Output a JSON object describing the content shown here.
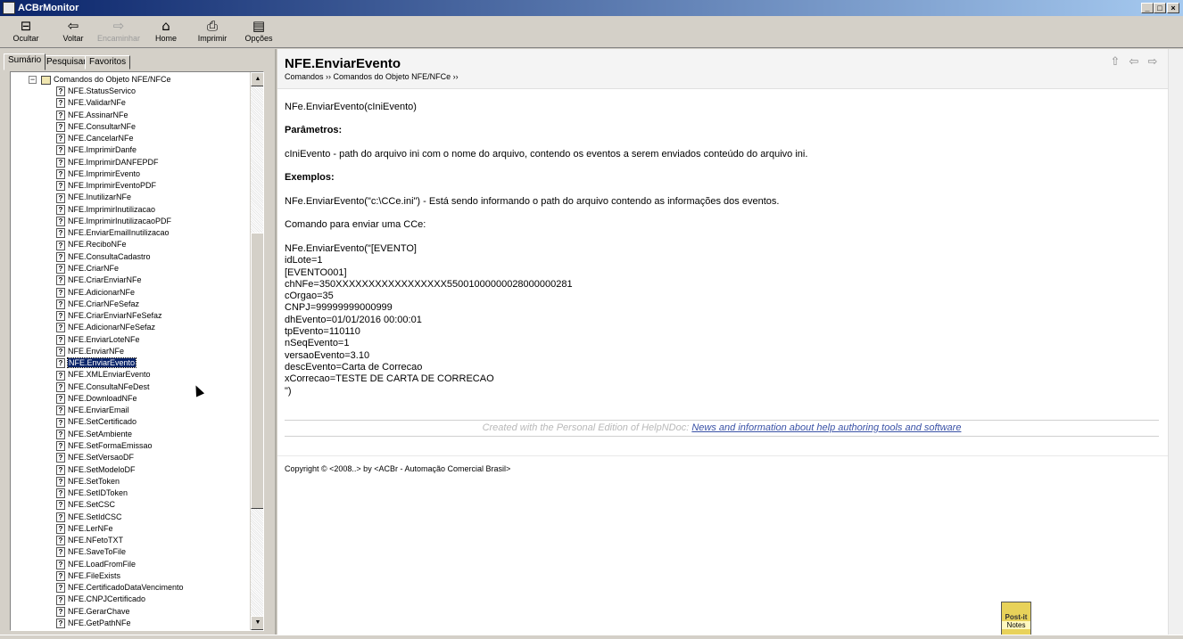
{
  "window": {
    "title": "ACBrMonitor"
  },
  "toolbar": [
    {
      "label": "Ocultar",
      "icon": "hide-icon",
      "glyph": "⊟",
      "enabled": true
    },
    {
      "label": "Voltar",
      "icon": "back-arrow-icon",
      "glyph": "⇦",
      "enabled": true
    },
    {
      "label": "Encaminhar",
      "icon": "forward-arrow-icon",
      "glyph": "⇨",
      "enabled": false
    },
    {
      "label": "Home",
      "icon": "home-icon",
      "glyph": "⌂",
      "enabled": true
    },
    {
      "label": "Imprimir",
      "icon": "print-icon",
      "glyph": "⎙",
      "enabled": true
    },
    {
      "label": "Opções",
      "icon": "options-icon",
      "glyph": "▤",
      "enabled": true
    }
  ],
  "tabs": [
    "Sumário",
    "Pesquisar",
    "Favoritos"
  ],
  "tree": {
    "root": "Comandos do Objeto NFE/NFCe",
    "selected": "NFE.EnviarEvento",
    "items": [
      "NFE.StatusServico",
      "NFE.ValidarNFe",
      "NFE.AssinarNFe",
      "NFE.ConsultarNFe",
      "NFE.CancelarNFe",
      "NFE.ImprimirDanfe",
      "NFE.ImprimirDANFEPDF",
      "NFE.ImprimirEvento",
      "NFE.ImprimirEventoPDF",
      "NFE.InutilizarNFe",
      "NFE.ImprimirInutilizacao",
      "NFE.ImprimirInutilizacaoPDF",
      "NFE.EnviarEmailInutilizacao",
      "NFE.ReciboNFe",
      "NFE.ConsultaCadastro",
      "NFE.CriarNFe",
      "NFE.CriarEnviarNFe",
      "NFE.AdicionarNFe",
      "NFE.CriarNFeSefaz",
      "NFE.CriarEnviarNFeSefaz",
      "NFE.AdicionarNFeSefaz",
      "NFE.EnviarLoteNFe",
      "NFE.EnviarNFe",
      "NFE.EnviarEvento",
      "NFE.XMLEnviarEvento",
      "NFE.ConsultaNFeDest",
      "NFE.DownloadNFe",
      "NFE.EnviarEmail",
      "NFE.SetCertificado",
      "NFE.SetAmbiente",
      "NFE.SetFormaEmissao",
      "NFE.SetVersaoDF",
      "NFE.SetModeloDF",
      "NFE.SetToken",
      "NFE.SetIDToken",
      "NFE.SetCSC",
      "NFE.SetIdCSC",
      "NFE.LerNFe",
      "NFE.NFetoTXT",
      "NFE.SaveToFile",
      "NFE.LoadFromFile",
      "NFE.FileExists",
      "NFE.CertificadoDataVencimento",
      "NFE.CNPJCertificado",
      "NFE.GerarChave",
      "NFE.GetPathNFe"
    ]
  },
  "content": {
    "title": "NFE.EnviarEvento",
    "breadcrumb": "Comandos ›› Comandos do Objeto NFE/NFCe ››",
    "signature": "NFe.EnviarEvento(cIniEvento)",
    "params_heading": "Parâmetros:",
    "param_desc": "cIniEvento - path do arquivo ini com o nome do arquivo, contendo os eventos a serem enviados conteúdo do arquivo ini.",
    "examples_heading": "Exemplos:",
    "example_desc": "NFe.EnviarEvento(\"c:\\CCe.ini\") - Está sendo informando o path do arquivo contendo as informações  dos eventos.",
    "cce_intro": "Comando para enviar uma CCe:",
    "code_lines": [
      "NFe.EnviarEvento(\"[EVENTO]",
      "idLote=1",
      "[EVENTO001]",
      "chNFe=350XXXXXXXXXXXXXXXXX55001000000028000000281",
      "cOrgao=35",
      "CNPJ=99999999000999",
      "dhEvento=01/01/2016 00:00:01",
      "tpEvento=110110",
      "nSeqEvento=1",
      "versaoEvento=3.10",
      "descEvento=Carta de Correcao",
      "xCorrecao=TESTE DE CARTA DE CORRECAO",
      "\")"
    ],
    "helpnote_prefix": "Created with the Personal Edition of HelpNDoc:",
    "helpnote_link": "News and information about help authoring tools and software",
    "copyright": "Copyright © <2008..> by <ACBr - Automação Comercial Brasil>"
  },
  "postit": {
    "brand": "Post-it",
    "sub": "Notes"
  }
}
